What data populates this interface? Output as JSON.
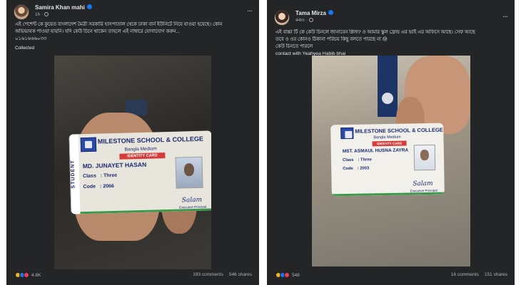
{
  "post1": {
    "author": "Samira Khan mahi",
    "time": "1h",
    "more_label": "...",
    "text_lines": [
      "এই পেশেন্ট কে কুয়েত বাংলাদেশ মৈত্রী সরকারি হাসপাতাল থেকে ঢাকা বার্ন ইউনিটে নিয়ে যাওয়া হয়েছে। কোন",
      "অভিভাবক পাওয়া যায়নি। যদি কেউ চিনে থাকেন তাহলে এই নাম্বারে যোগাযোগ করুন...",
      "০১৬১৬৬৬০৩৩"
    ],
    "collected": "Collected",
    "card": {
      "vertical_text": "STUDENT",
      "school": "MILESTONE SCHOOL & COLLEGE",
      "medium": "Bangla Medium",
      "id_label": "IDENTITY CARD",
      "name": "MD. JUNAYET HASAN",
      "class_label": "Class",
      "class_value": ": Three",
      "code_label": "Code",
      "code_value": ": 2066",
      "signature": "Salam",
      "role": "Executive Principal"
    },
    "reactions": [
      "haha",
      "like",
      "love"
    ],
    "reaction_count": "4.6K",
    "comments": "193 comments",
    "shares": "546 shares"
  },
  "post2": {
    "author": "Tama Mirza",
    "time": "44m",
    "more_label": "...",
    "text_lines": [
      "এই বাচ্চা টি কে কেউ চিনলে জানাবেন প্লিজ? ও আমার স্কুল ফ্রেন্ড এর ভাই এর অফিসে আছে। সেফ আছে",
      "তবে ও ওর কোনও ঠিকানা পরিচয় কিছু বলতে পারছে না 😢",
      "কেউ চিনতে পারলে"
    ],
    "contact": "contact with Yeahyea Habib bhai",
    "card": {
      "vertical_text": "",
      "school": "MILESTONE SCHOOL & COLLEGE",
      "medium": "Bangla Medium",
      "id_label": "IDENTITY CARD",
      "name": "MST. ASMAUL HUSNA ZAYRA",
      "class_label": "Class",
      "class_value": ": Three",
      "code_label": "Code",
      "code_value": ": 2003",
      "signature": "Salam",
      "role": "Executive Principal"
    },
    "reactions": [
      "haha",
      "like",
      "love"
    ],
    "reaction_count": "548",
    "comments": "16 comments",
    "shares": "151 shares"
  },
  "colors": {
    "post_bg": "#242526",
    "text": "#e4e6eb",
    "muted": "#b0b3b8",
    "accent": "#1877f2",
    "card_text": "#1a2a70",
    "id_red": "#d63b3b"
  },
  "icons": {
    "verified": "verified-badge-icon",
    "privacy": "friends-icon",
    "more": "more-options-icon"
  }
}
